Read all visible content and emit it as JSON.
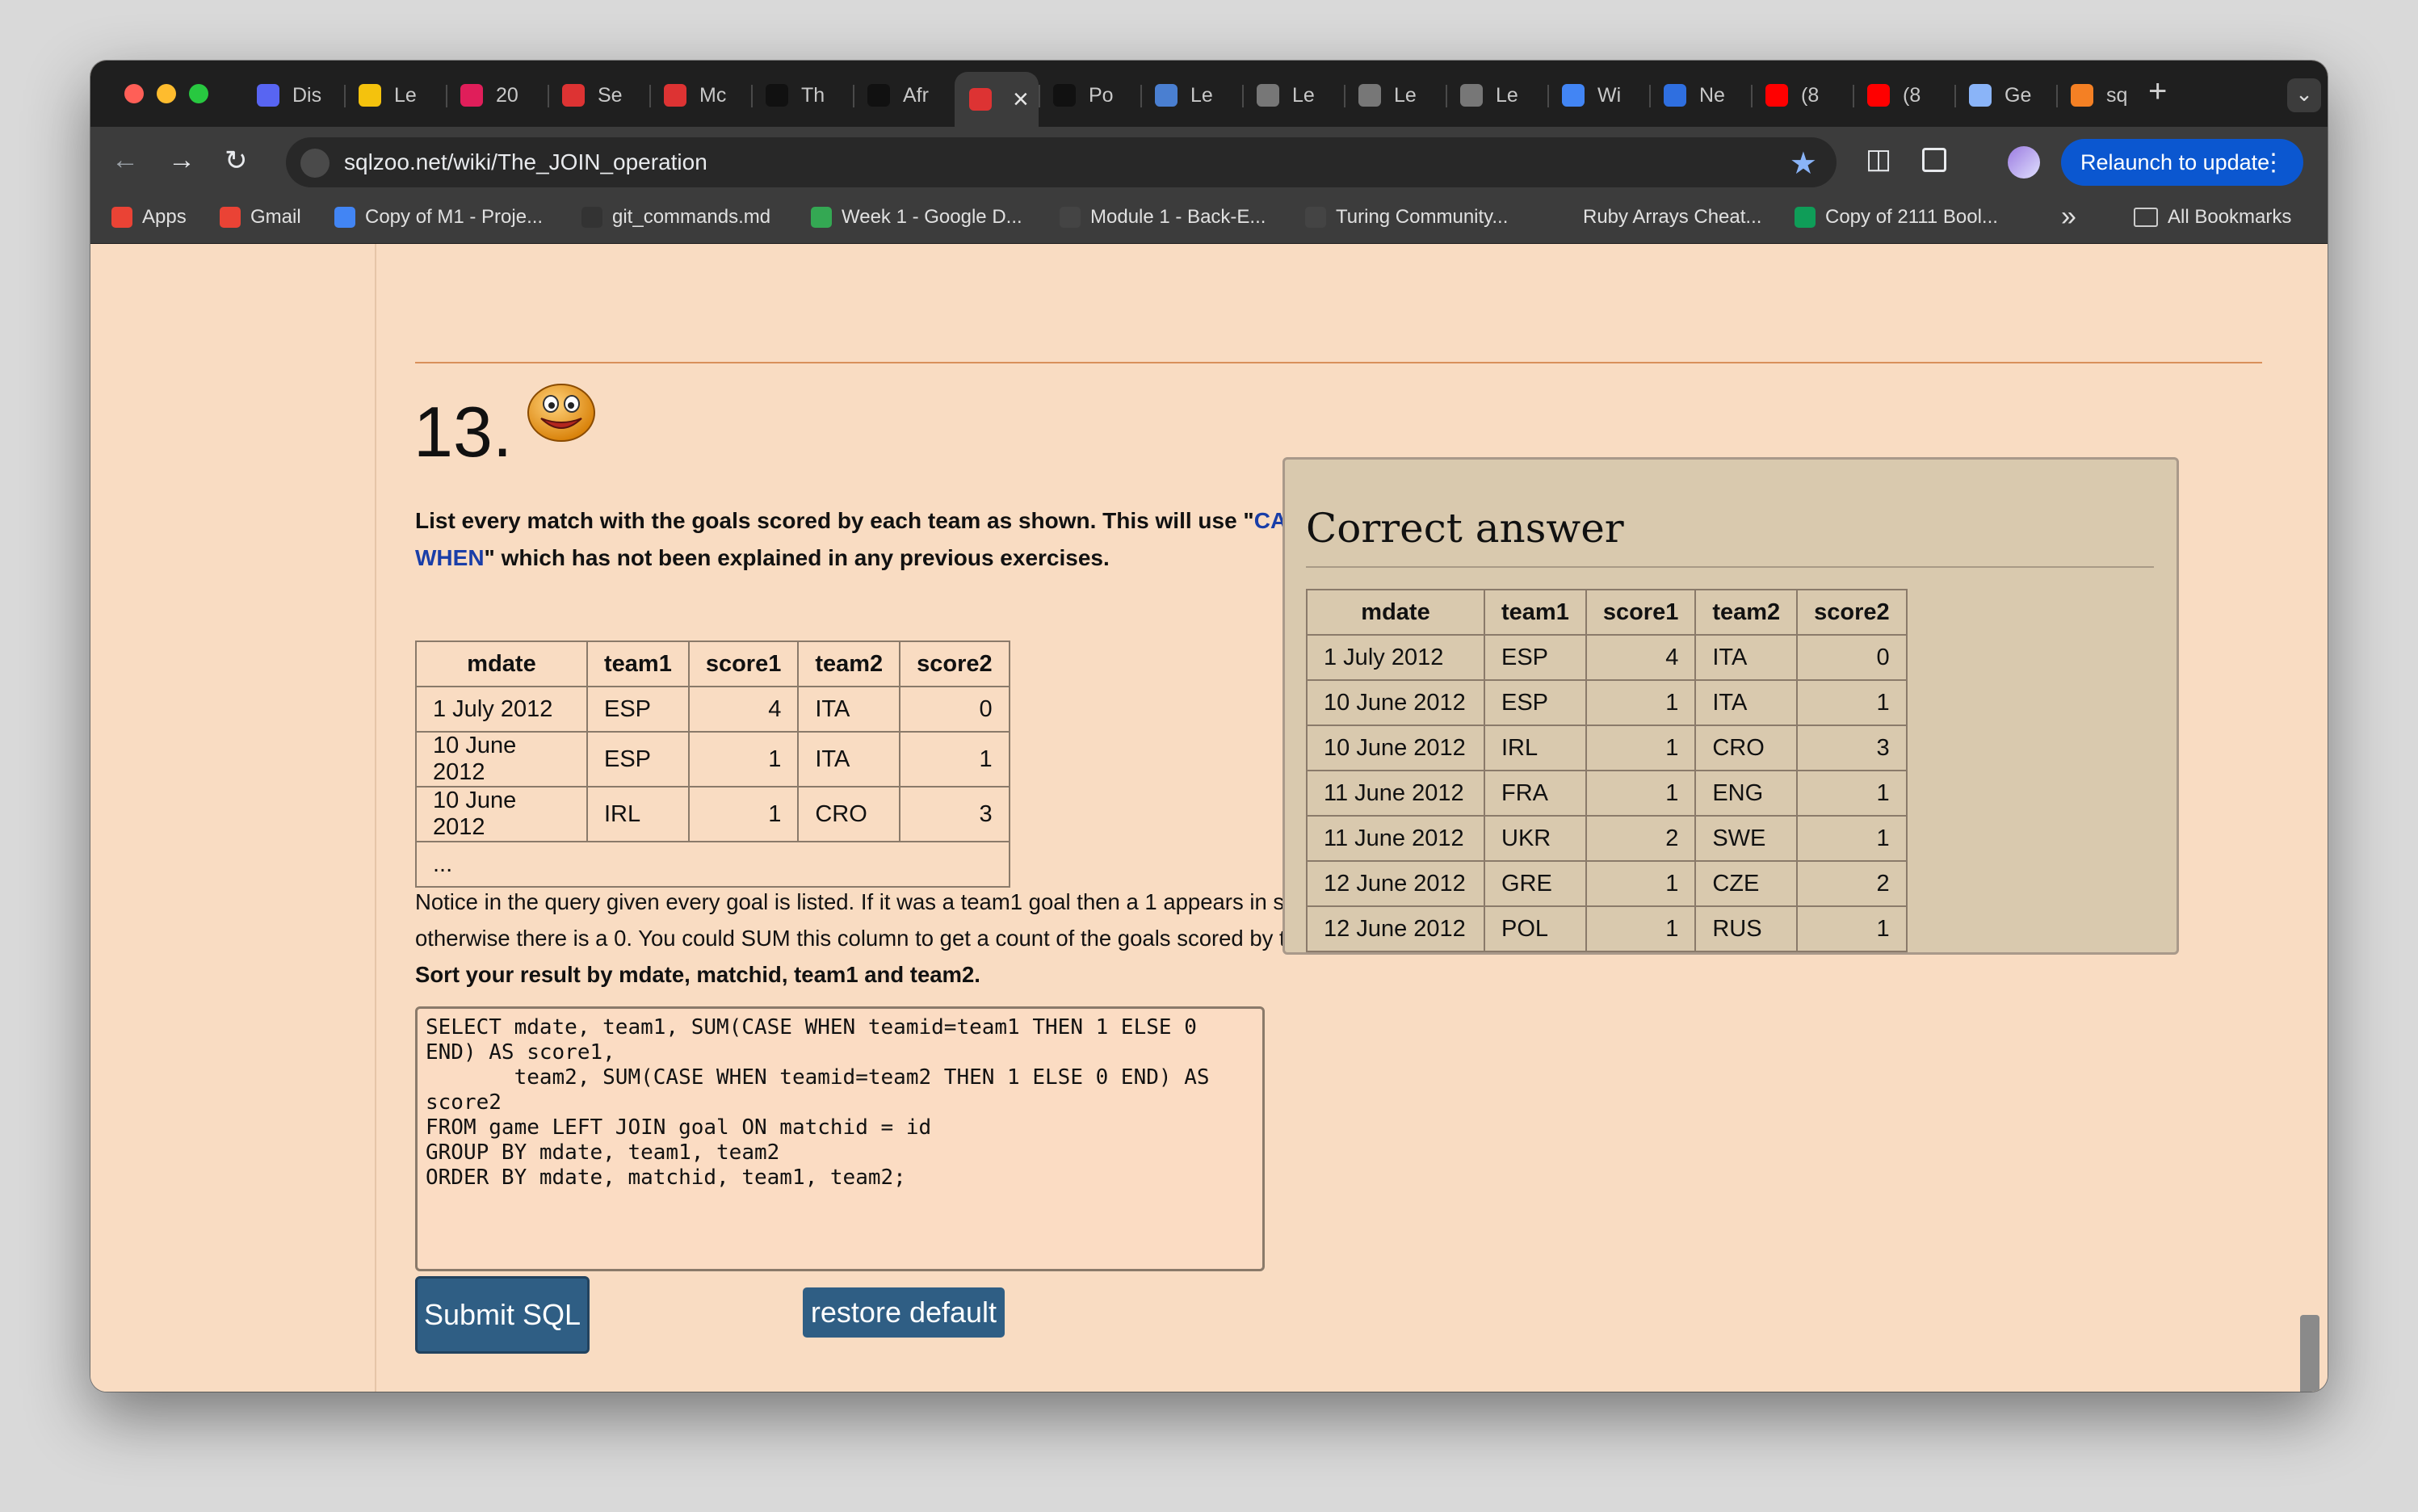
{
  "browser": {
    "tabs": [
      {
        "label": "Dis",
        "icon": "discord-icon",
        "color": "#5865f2"
      },
      {
        "label": "Le",
        "icon": "key-icon",
        "color": "#f4c20d"
      },
      {
        "label": "20",
        "icon": "slack-icon",
        "color": "#e01e5a"
      },
      {
        "label": "Se",
        "icon": "sqlzoo-icon",
        "color": "#d33"
      },
      {
        "label": "Mc",
        "icon": "sqlzoo-icon",
        "color": "#d33"
      },
      {
        "label": "Th",
        "icon": "hackernoon-icon",
        "color": "#111"
      },
      {
        "label": "Afr",
        "icon": "hackernoon-icon",
        "color": "#111"
      },
      {
        "label": "",
        "icon": "sqlzoo-icon",
        "color": "#d33",
        "active": true
      },
      {
        "label": "Po",
        "icon": "hackernoon-icon",
        "color": "#111"
      },
      {
        "label": "Le",
        "icon": "graduation-icon",
        "color": "#4a7fd1"
      },
      {
        "label": "Le",
        "icon": "globe-icon",
        "color": "#777"
      },
      {
        "label": "Le",
        "icon": "globe-icon",
        "color": "#777"
      },
      {
        "label": "Le",
        "icon": "globe-icon",
        "color": "#777"
      },
      {
        "label": "Wi",
        "icon": "docs-icon",
        "color": "#4285f4"
      },
      {
        "label": "Ne",
        "icon": "database-icon",
        "color": "#2f6fe0"
      },
      {
        "label": "(8",
        "icon": "youtube-icon",
        "color": "#f00"
      },
      {
        "label": "(8",
        "icon": "youtube-icon",
        "color": "#f00"
      },
      {
        "label": "Ge",
        "icon": "gemini-icon",
        "color": "#8ab4f8"
      },
      {
        "label": "sq",
        "icon": "stackoverflow-icon",
        "color": "#f48024"
      }
    ],
    "new_tab": "+",
    "tab_search": "⌄",
    "url": "sqlzoo.net/wiki/The_JOIN_operation",
    "relaunch": "Relaunch to update",
    "bookmarks": [
      {
        "label": "Apps",
        "icon": "apps-icon",
        "color": "#ea4335"
      },
      {
        "label": "Gmail",
        "icon": "gmail-icon",
        "color": "#ea4335"
      },
      {
        "label": "Copy of M1 - Proje...",
        "icon": "docs-icon",
        "color": "#4285f4"
      },
      {
        "label": "git_commands.md",
        "icon": "github-icon",
        "color": "#333"
      },
      {
        "label": "Week 1 - Google D...",
        "icon": "drive-icon",
        "color": "#34a853"
      },
      {
        "label": "Module 1 - Back-E...",
        "icon": "turing-icon",
        "color": "#444"
      },
      {
        "label": "Turing Community...",
        "icon": "turing-icon",
        "color": "#444"
      },
      {
        "label": "Ruby Arrays Cheat...",
        "icon": "blank-icon",
        "color": "#3c3c3c"
      },
      {
        "label": "Copy of 2111 Bool...",
        "icon": "sheets-icon",
        "color": "#0f9d58"
      }
    ],
    "more_bookmarks": "»",
    "all_bookmarks": "All Bookmarks"
  },
  "exercise": {
    "number": "13.",
    "intro_part1": "List every match with the goals scored by each team as shown. This will use \"",
    "intro_link": "CASE WHEN",
    "intro_part2": "\" which has not been explained in any previous exercises.",
    "example_headers": [
      "mdate",
      "team1",
      "score1",
      "team2",
      "score2"
    ],
    "example_rows": [
      [
        "1 July 2012",
        "ESP",
        "4",
        "ITA",
        "0"
      ],
      [
        "10 June 2012",
        "ESP",
        "1",
        "ITA",
        "1"
      ],
      [
        "10 June 2012",
        "IRL",
        "1",
        "CRO",
        "3"
      ]
    ],
    "ellipsis": "...",
    "notice_text": "Notice in the query given every goal is listed. If it was a team1 goal then a 1 appears in score1, otherwise there is a 0. You could SUM this column to get a count of the goals scored by team1. ",
    "notice_bold": "Sort your result by mdate, matchid, team1 and team2.",
    "sql": "SELECT mdate, team1, SUM(CASE WHEN teamid=team1 THEN 1 ELSE 0\nEND) AS score1,\n       team2, SUM(CASE WHEN teamid=team2 THEN 1 ELSE 0 END) AS\nscore2\nFROM game LEFT JOIN goal ON matchid = id\nGROUP BY mdate, team1, team2\nORDER BY mdate, matchid, team1, team2;",
    "submit_label": "Submit SQL",
    "restore_label": "restore default"
  },
  "answer": {
    "title": "Correct answer",
    "headers": [
      "mdate",
      "team1",
      "score1",
      "team2",
      "score2"
    ],
    "rows": [
      [
        "1 July 2012",
        "ESP",
        "4",
        "ITA",
        "0"
      ],
      [
        "10 June 2012",
        "ESP",
        "1",
        "ITA",
        "1"
      ],
      [
        "10 June 2012",
        "IRL",
        "1",
        "CRO",
        "3"
      ],
      [
        "11 June 2012",
        "FRA",
        "1",
        "ENG",
        "1"
      ],
      [
        "11 June 2012",
        "UKR",
        "2",
        "SWE",
        "1"
      ],
      [
        "12 June 2012",
        "GRE",
        "1",
        "CZE",
        "2"
      ],
      [
        "12 June 2012",
        "POL",
        "1",
        "RUS",
        "1"
      ]
    ]
  }
}
